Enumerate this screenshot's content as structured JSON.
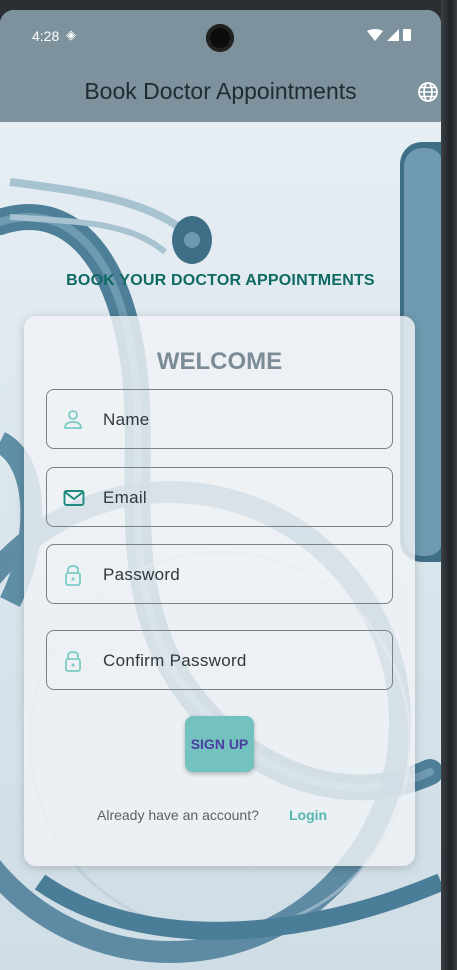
{
  "status_bar": {
    "time": "4:28"
  },
  "app_bar": {
    "title": "Book Doctor Appointments"
  },
  "tagline": "BOOK YOUR DOCTOR APPOINTMENTS",
  "card": {
    "heading": "WELCOME",
    "fields": [
      {
        "placeholder": "Name",
        "icon": "person-icon"
      },
      {
        "placeholder": "Email",
        "icon": "mail-icon"
      },
      {
        "placeholder": "Password",
        "icon": "lock-icon"
      },
      {
        "placeholder": "Confirm Password",
        "icon": "lock-icon"
      }
    ],
    "signup_label": "SIGN UP",
    "account_prompt": "Already have an account?",
    "login_label": "Login"
  },
  "colors": {
    "app_bar": "#7d929c",
    "tagline": "#0e6a62",
    "accent": "#74c2bf",
    "button_text": "#4a3fa0",
    "link": "#54b6ae"
  }
}
